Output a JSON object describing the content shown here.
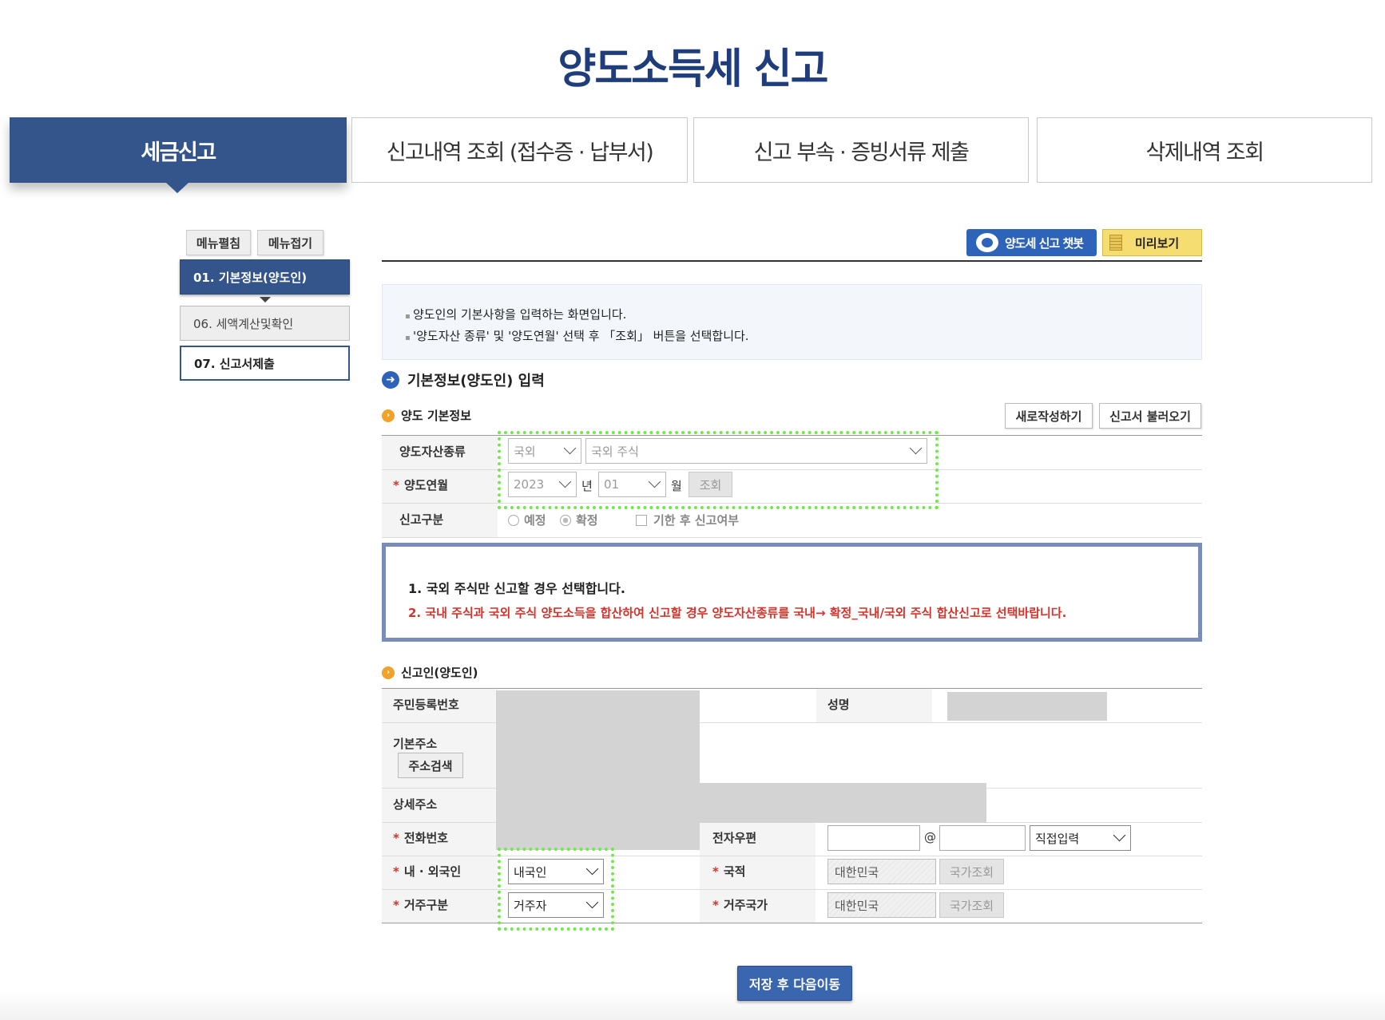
{
  "page_title": "양도소득세 신고",
  "tabs": [
    {
      "label": "세금신고",
      "active": true
    },
    {
      "label": "신고내역 조회 (접수증 · 납부서)"
    },
    {
      "label": "신고 부속 · 증빙서류 제출"
    },
    {
      "label": "삭제내역 조회"
    }
  ],
  "side_menu": {
    "expand_label": "메뉴펼침",
    "collapse_label": "메뉴접기",
    "items": [
      {
        "label": "01. 기본정보(양도인)"
      },
      {
        "label": "06. 세액계산및확인"
      },
      {
        "label": "07. 신고서제출"
      }
    ]
  },
  "top_buttons": {
    "chatbot_label": "양도세 신고 챗봇",
    "preview_label": "미리보기"
  },
  "info_lines": [
    "양도인의 기본사항을 입력하는 화면입니다.",
    "'양도자산 종류' 및 '양도연월' 선택 후 「조회」 버튼을 선택합니다."
  ],
  "section_title": "기본정보(양도인) 입력",
  "transfer_basic": {
    "heading": "양도 기본정보",
    "new_button": "새로작성하기",
    "load_button": "신고서 불러오기",
    "asset_type_label": "양도자산종류",
    "asset_type_value": "국외",
    "asset_subtype_value": "국외 주식",
    "month_label": "양도연월",
    "year_value": "2023",
    "year_unit": "년",
    "month_value": "01",
    "month_unit": "월",
    "lookup_button": "조회",
    "report_type_label": "신고구분",
    "option_planned": "예정",
    "option_final": "확정",
    "option_late": "기한 후 신고여부"
  },
  "notice": {
    "line1": "1. 국외 주식만 신고할 경우 선택합니다.",
    "line2": "2. 국내 주식과 국외 주식 양도소득을 합산하여 신고할 경우 양도자산종류를 국내→ 확정_국내/국외 주식 합산신고로 선택바랍니다."
  },
  "applicant": {
    "heading": "신고인(양도인)",
    "rrn_label": "주민등록번호",
    "name_label": "성명",
    "address_label": "기본주소",
    "address_search_button": "주소검색",
    "detail_address_label": "상세주소",
    "phone_label": "전화번호",
    "email_label": "전자우편",
    "email_at": "@",
    "email_domain_select": "직접입력",
    "residency_type_label": "내 · 외국인",
    "residency_type_value": "내국인",
    "nationality_label": "국적",
    "nationality_value": "대한민국",
    "nationality_button": "국가조회",
    "residence_label": "거주구분",
    "residence_value": "거주자",
    "residence_country_label": "거주국가",
    "residence_country_value": "대한민국",
    "residence_country_button": "국가조회"
  },
  "save_button": "저장 후 다음이동",
  "colors": {
    "primary": "#34558c",
    "title": "#1f3d7a",
    "highlight": "#73e84a",
    "warning": "#d6332b",
    "preview": "#f6dd72"
  }
}
